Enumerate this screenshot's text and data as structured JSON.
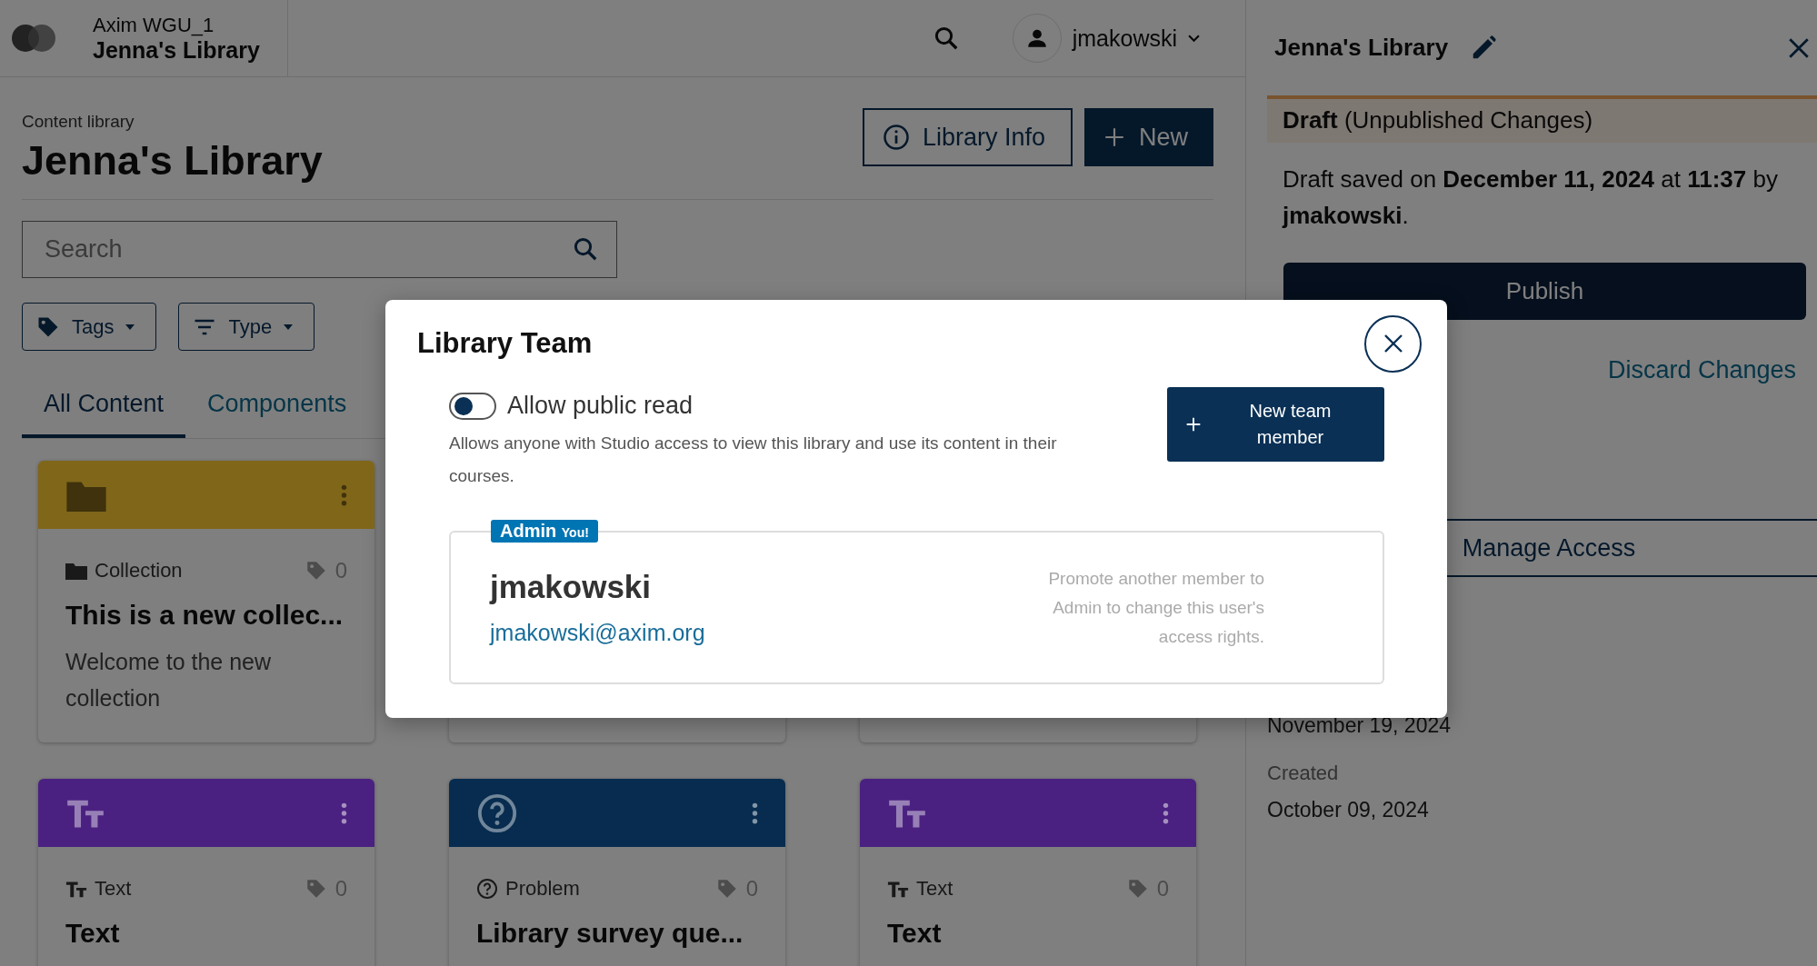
{
  "header": {
    "org": "Axim WGU_1",
    "library": "Jenna's Library",
    "user": "jmakowski"
  },
  "main": {
    "eyebrow": "Content library",
    "title": "Jenna's Library",
    "actions": [
      {
        "label": "Library Info",
        "kind": "outline"
      },
      {
        "label": "New",
        "kind": "primary"
      }
    ],
    "search": {
      "placeholder": "Search"
    },
    "filters": [
      {
        "label": "Tags",
        "kind": "tag"
      },
      {
        "label": "Type",
        "kind": "filter"
      }
    ],
    "tabs": [
      {
        "label": "All Content",
        "selected": true
      },
      {
        "label": "Components",
        "selected": false
      }
    ],
    "cards": [
      {
        "kind": "collection",
        "color": "#806619",
        "type_label": "Collection",
        "tag_count": "0",
        "title": "This is a new collec...",
        "description": "Welcome to the new collection"
      },
      {
        "kind": "covered"
      },
      {
        "kind": "covered"
      },
      {
        "kind": "text",
        "color": "#4a2180",
        "type_label": "Text",
        "tag_count": "0",
        "title": "Text"
      },
      {
        "kind": "problem",
        "color": "#072c4f",
        "type_label": "Problem",
        "tag_count": "0",
        "title": "Library survey que..."
      },
      {
        "kind": "text",
        "color": "#4a2180",
        "type_label": "Text",
        "tag_count": "0",
        "title": "Text"
      }
    ]
  },
  "sidebar": {
    "title": "Jenna's Library",
    "status": "**Draft** (Unpublished Changes)",
    "saved": "Draft saved on **December 11, 2024** at **11:37** by **jmakowski**.",
    "publish": "Publish",
    "discard": "Discard Changes",
    "manage": "Manage Access",
    "modified_date": "November 19, 2024",
    "created_label": "Created",
    "created_date": "October 09, 2024"
  },
  "modal": {
    "title": "Library Team",
    "public_read": {
      "label": "Allow public read",
      "on": false
    },
    "description": "Allows anyone with Studio access to view this library and use its content in their courses.",
    "add_button": "New team member",
    "members": [
      {
        "role": "Admin",
        "you": "You!",
        "name": "jmakowski",
        "email": "jmakowski@axim.org",
        "note": "Promote another member to Admin to change this user's access rights."
      }
    ]
  }
}
